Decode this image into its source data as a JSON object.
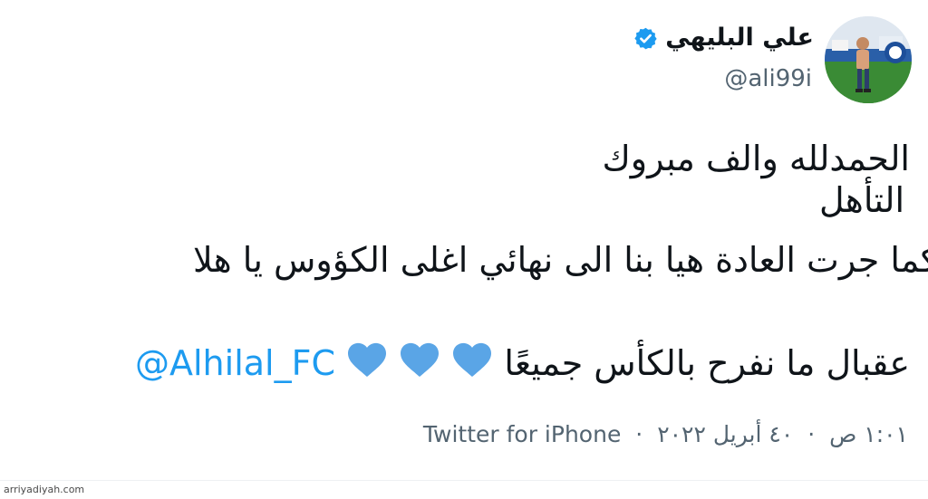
{
  "tweet": {
    "author": {
      "display_name": "علي البليهي",
      "handle": "@ali99i",
      "verified": true
    },
    "lines": {
      "line1": "الحمدلله والف مبروك",
      "line2": "التأهل",
      "line3": "كما جرت العادة هيا بنا الى نهائي اغلى الكؤوس يا هلا",
      "line4_text": "عقبال ما نفرح بالكأس جميعًا",
      "mention": "@Alhilal_FC"
    },
    "meta": {
      "time": "١:٠١ ص",
      "separator": "·",
      "date": "٤٠ أبريل ٢٠٢٢",
      "source": "Twitter for iPhone"
    }
  },
  "watermark": "arriyadiyah.com",
  "colors": {
    "accent": "#1d9bf0",
    "heart": "#5aa5e6",
    "secondary_text": "#536471",
    "primary_text": "#0f1419"
  },
  "icons": {
    "verified": "verified-badge-icon",
    "heart": "blue-heart-icon"
  }
}
